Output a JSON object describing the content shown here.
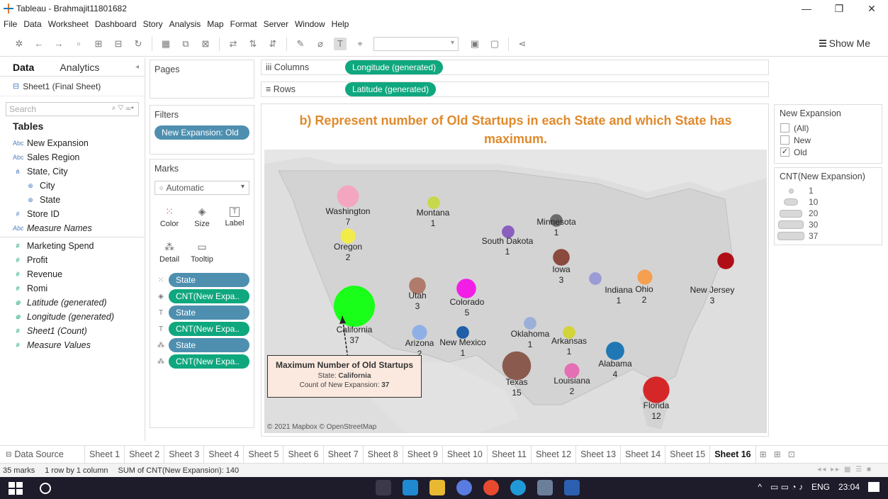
{
  "window": {
    "title": "Tableau - Brahmajit11801682"
  },
  "menu": [
    "File",
    "Data",
    "Worksheet",
    "Dashboard",
    "Story",
    "Analysis",
    "Map",
    "Format",
    "Server",
    "Window",
    "Help"
  ],
  "toolbar": {
    "show_me": "Show Me"
  },
  "data_pane": {
    "tabs": [
      "Data",
      "Analytics"
    ],
    "source": "Sheet1 (Final Sheet)",
    "search_placeholder": "Search",
    "tables_heading": "Tables",
    "fields": [
      {
        "label": "New Expansion",
        "icon": "Abc",
        "kind": "dim",
        "indent": false,
        "italic": false
      },
      {
        "label": "Sales Region",
        "icon": "Abc",
        "kind": "dim",
        "indent": false,
        "italic": false
      },
      {
        "label": "State, City",
        "icon": "⋔",
        "kind": "dim",
        "indent": false,
        "italic": false
      },
      {
        "label": "City",
        "icon": "⊕",
        "kind": "dim",
        "indent": true,
        "italic": false
      },
      {
        "label": "State",
        "icon": "⊕",
        "kind": "dim",
        "indent": true,
        "italic": false
      },
      {
        "label": "Store ID",
        "icon": "#",
        "kind": "dim",
        "indent": false,
        "italic": false
      },
      {
        "label": "Measure Names",
        "icon": "Abc",
        "kind": "dim",
        "indent": false,
        "italic": true
      },
      {
        "label": "Marketing Spend",
        "icon": "#",
        "kind": "measure",
        "indent": false,
        "italic": false
      },
      {
        "label": "Profit",
        "icon": "#",
        "kind": "measure",
        "indent": false,
        "italic": false
      },
      {
        "label": "Revenue",
        "icon": "#",
        "kind": "measure",
        "indent": false,
        "italic": false
      },
      {
        "label": "Romi",
        "icon": "#",
        "kind": "measure",
        "indent": false,
        "italic": false
      },
      {
        "label": "Latitude (generated)",
        "icon": "⊕",
        "kind": "measure",
        "indent": false,
        "italic": true
      },
      {
        "label": "Longitude (generated)",
        "icon": "⊕",
        "kind": "measure",
        "indent": false,
        "italic": true
      },
      {
        "label": "Sheet1 (Count)",
        "icon": "#",
        "kind": "measure",
        "indent": false,
        "italic": true
      },
      {
        "label": "Measure Values",
        "icon": "#",
        "kind": "measure",
        "indent": false,
        "italic": true
      }
    ]
  },
  "pages": {
    "title": "Pages"
  },
  "filters": {
    "title": "Filters",
    "items": [
      "New Expansion: Old"
    ]
  },
  "marks": {
    "title": "Marks",
    "type": "Automatic",
    "buttons": [
      {
        "label": "Color",
        "icon": "⁙"
      },
      {
        "label": "Size",
        "icon": "◈"
      },
      {
        "label": "Label",
        "icon": "T"
      },
      {
        "label": "Detail",
        "icon": "⁂"
      },
      {
        "label": "Tooltip",
        "icon": "▭"
      }
    ],
    "fields": [
      {
        "icon": "⁙",
        "label": "State",
        "color": "blue"
      },
      {
        "icon": "◈",
        "label": "CNT(New Expa..",
        "color": "green"
      },
      {
        "icon": "T",
        "label": "State",
        "color": "blue"
      },
      {
        "icon": "T",
        "label": "CNT(New Expa..",
        "color": "green"
      },
      {
        "icon": "⁂",
        "label": "State",
        "color": "blue"
      },
      {
        "icon": "⁂",
        "label": "CNT(New Expa..",
        "color": "green"
      }
    ]
  },
  "shelves": {
    "columns_label": "iii Columns",
    "columns_pill": "Longitude (generated)",
    "rows_label": "≡ Rows",
    "rows_pill": "Latitude (generated)"
  },
  "sheet": {
    "title_line1": "b) Represent number of Old Startups in each State and which State has",
    "title_line2": "maximum.",
    "attribution": "© 2021 Mapbox © OpenStreetMap"
  },
  "map_points": [
    {
      "state": "Washington",
      "count": 7,
      "color": "#f4a6c0"
    },
    {
      "state": "Montana",
      "count": 1,
      "color": "#c7d84a"
    },
    {
      "state": "Oregon",
      "count": 2,
      "color": "#f2ec4a"
    },
    {
      "state": "Minnesota",
      "count": 1,
      "color": "#6b6b6b"
    },
    {
      "state": "South Dakota",
      "count": 1,
      "color": "#8a5fc0"
    },
    {
      "state": "Iowa",
      "count": 3,
      "color": "#8b4a3e"
    },
    {
      "state": "California",
      "count": 37,
      "color": "#19ff19"
    },
    {
      "state": "Utah",
      "count": 3,
      "color": "#b07b6a"
    },
    {
      "state": "Colorado",
      "count": 5,
      "color": "#f21ee6"
    },
    {
      "state": "Indiana",
      "count": 1,
      "color": "#9b9bd6"
    },
    {
      "state": "Ohio",
      "count": 2,
      "color": "#f5a050"
    },
    {
      "state": "New Jersey",
      "count": 3,
      "color": "#b00f17"
    },
    {
      "state": "Oklahoma",
      "count": 1,
      "color": "#9bb0d8"
    },
    {
      "state": "Arizona",
      "count": 2,
      "color": "#8fb0e6"
    },
    {
      "state": "New Mexico",
      "count": 1,
      "color": "#1f5fa8"
    },
    {
      "state": "Arkansas",
      "count": 1,
      "color": "#d3d33a"
    },
    {
      "state": "Alabama",
      "count": 4,
      "color": "#1f77b4"
    },
    {
      "state": "Texas",
      "count": 15,
      "color": "#8b5a4e"
    },
    {
      "state": "Louisiana",
      "count": 2,
      "color": "#e56fb5"
    },
    {
      "state": "Florida",
      "count": 12,
      "color": "#d62728"
    }
  ],
  "tooltip": {
    "title": "Maximum Number of Old Startups",
    "state_label": "State:",
    "state_value": "California",
    "count_label": "Count of New Expansion:",
    "count_value": "37"
  },
  "legend_expansion": {
    "title": "New Expansion",
    "items": [
      {
        "label": "(All)",
        "checked": false
      },
      {
        "label": "New",
        "checked": false
      },
      {
        "label": "Old",
        "checked": true
      }
    ]
  },
  "legend_count": {
    "title": "CNT(New Expansion)",
    "items": [
      "1",
      "10",
      "20",
      "30",
      "37"
    ]
  },
  "sheet_tabs": {
    "data_source": "Data Source",
    "tabs": [
      "Sheet 1",
      "Sheet 2",
      "Sheet 3",
      "Sheet 4",
      "Sheet 5",
      "Sheet 6",
      "Sheet 7",
      "Sheet 8",
      "Sheet 9",
      "Sheet 10",
      "Sheet 11",
      "Sheet 12",
      "Sheet 13",
      "Sheet 14",
      "Sheet 15",
      "Sheet 16"
    ],
    "active": "Sheet 16"
  },
  "status": {
    "marks": "35 marks",
    "layout": "1 row by 1 column",
    "sum": "SUM of CNT(New Expansion): 140"
  },
  "taskbar": {
    "lang": "ENG",
    "time": "23:04"
  }
}
